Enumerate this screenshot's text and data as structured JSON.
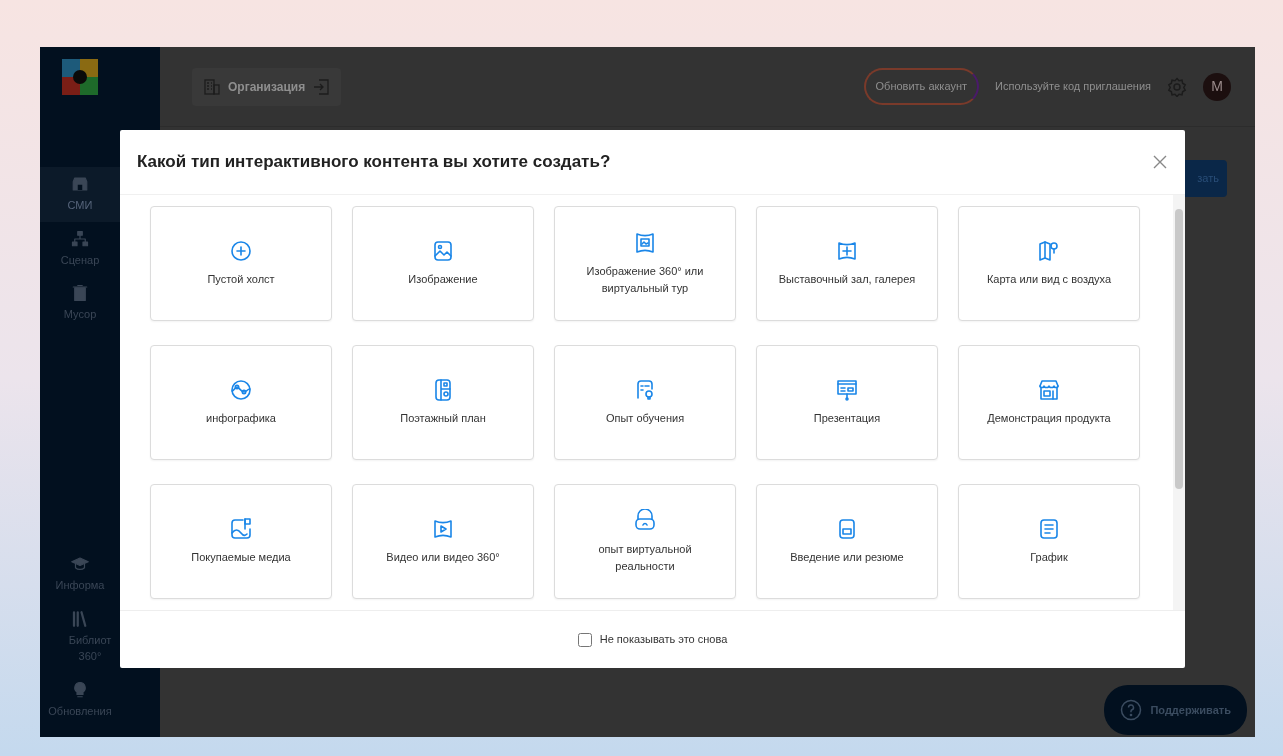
{
  "sidebar": {
    "items": [
      {
        "label": "СМИ",
        "selected": true
      },
      {
        "label": "Сценар",
        "selected": false
      },
      {
        "label": "Мусор",
        "selected": false
      },
      {
        "label": "Информа",
        "selected": false
      },
      {
        "label": "Библиот 360°",
        "selected": false
      },
      {
        "label": "Обновления",
        "selected": false
      }
    ]
  },
  "topbar": {
    "organization": "Организация",
    "upgrade_button": "Обновить аккаунт",
    "invite_link": "Используйте код приглашения",
    "avatar": "M"
  },
  "background_button": "зать",
  "modal": {
    "title": "Какой тип интерактивного контента вы хотите создать?",
    "options": [
      {
        "label": "Пустой холст"
      },
      {
        "label": "Изображение"
      },
      {
        "label": "Изображение 360° или виртуальный тур"
      },
      {
        "label": "Выставочный зал, галерея"
      },
      {
        "label": "Карта или вид с воздуха"
      },
      {
        "label": "инфографика"
      },
      {
        "label": "Поэтажный план"
      },
      {
        "label": "Опыт обучения"
      },
      {
        "label": "Презентация"
      },
      {
        "label": "Демонстрация продукта"
      },
      {
        "label": "Покупаемые медиа"
      },
      {
        "label": "Видео или видео 360°"
      },
      {
        "label": "опыт виртуальной реальности"
      },
      {
        "label": "Введение или резюме"
      },
      {
        "label": "График"
      }
    ],
    "dont_show_again": {
      "label": "Не показывать это снова",
      "checked": false
    }
  },
  "support_button": "Поддерживать"
}
